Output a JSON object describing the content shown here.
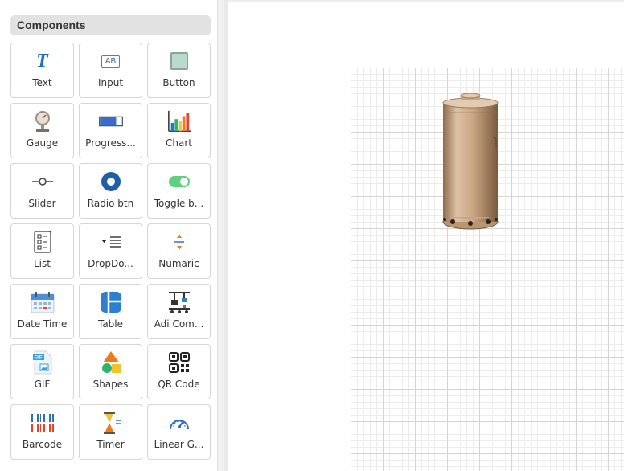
{
  "sidebar": {
    "title": "Components",
    "components": [
      {
        "label": "Text",
        "icon": "text-icon"
      },
      {
        "label": "Input",
        "icon": "input-icon"
      },
      {
        "label": "Button",
        "icon": "button-icon"
      },
      {
        "label": "Gauge",
        "icon": "gauge-icon"
      },
      {
        "label": "Progress...",
        "icon": "progress-bar-icon"
      },
      {
        "label": "Chart",
        "icon": "bar-chart-icon"
      },
      {
        "label": "Slider",
        "icon": "slider-icon"
      },
      {
        "label": "Radio btn",
        "icon": "radio-button-icon"
      },
      {
        "label": "Toggle b...",
        "icon": "toggle-switch-icon"
      },
      {
        "label": "List",
        "icon": "list-icon"
      },
      {
        "label": "DropDo...",
        "icon": "dropdown-icon"
      },
      {
        "label": "Numaric",
        "icon": "numeric-stepper-icon"
      },
      {
        "label": "Date Time",
        "icon": "calendar-icon"
      },
      {
        "label": "Table",
        "icon": "table-icon"
      },
      {
        "label": "Adi Com...",
        "icon": "conveyor-machine-icon"
      },
      {
        "label": "GIF",
        "icon": "gif-file-icon"
      },
      {
        "label": "Shapes",
        "icon": "shapes-icon"
      },
      {
        "label": "QR Code",
        "icon": "qr-code-icon"
      },
      {
        "label": "Barcode",
        "icon": "barcode-icon"
      },
      {
        "label": "Timer",
        "icon": "hourglass-icon"
      },
      {
        "label": "Linear G...",
        "icon": "speedometer-icon"
      }
    ],
    "icon_text": {
      "text": "T",
      "input": "AB"
    }
  },
  "canvas": {
    "placed_component": "storage-tank-icon"
  },
  "colors": {
    "accent_blue": "#1f6fc5",
    "tank": "#c9a683",
    "toggle_green": "#5fcf80"
  }
}
